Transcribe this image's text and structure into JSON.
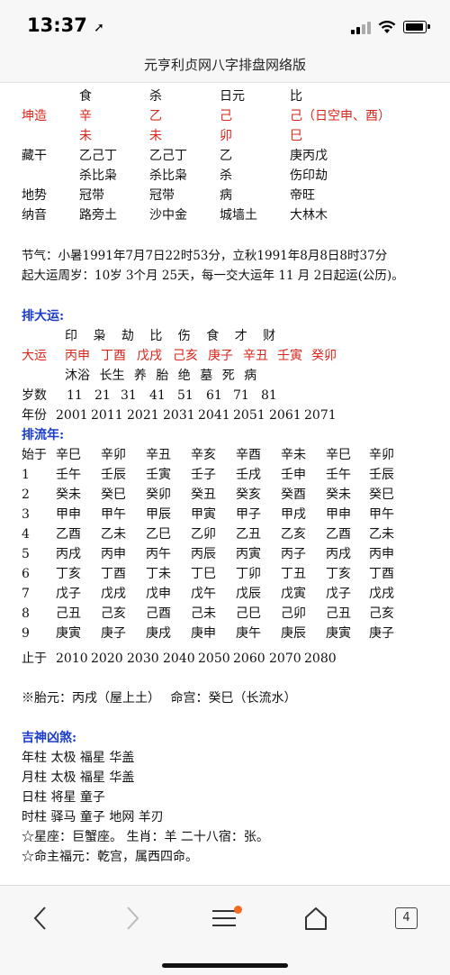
{
  "status": {
    "time": "13:37"
  },
  "page": {
    "title": "元亨利贞网八字排盘网络版"
  },
  "chart": {
    "header_row": [
      "食",
      "杀",
      "日元",
      "比"
    ],
    "kun_label": "坤造",
    "stems": [
      "辛",
      "乙",
      "己",
      "己（日空申、酉）"
    ],
    "branches": [
      "未",
      "未",
      "卯",
      "巳"
    ],
    "cang_label": "藏干",
    "cang": [
      "乙己丁",
      "乙己丁",
      "乙",
      "庚丙戊"
    ],
    "cang_gods": [
      "杀比枭",
      "杀比枭",
      "杀",
      "伤印劫"
    ],
    "dishi_label": "地势",
    "dishi": [
      "冠带",
      "冠带",
      "病",
      "帝旺"
    ],
    "nayin_label": "纳音",
    "nayin": [
      "路旁土",
      "沙中金",
      "城墙土",
      "大林木"
    ]
  },
  "info": {
    "jieqi": "节气：小暑1991年7月7日22时53分，立秋1991年8月8日8时37分",
    "qiyun": "起大运周岁：10岁 3个月 25天，每一交大运年 11 月 2日起运(公历)。"
  },
  "dayun": {
    "heading": "排大运:",
    "gods_row": "印 枭 劫 比 伤 食 才 财",
    "label": "大运",
    "pillars": [
      "丙申",
      "丁酉",
      "戊戌",
      "己亥",
      "庚子",
      "辛丑",
      "壬寅",
      "癸卯"
    ],
    "states_row": "沐浴 长生 养 胎 绝 墓 死 病",
    "age_label": "岁数",
    "ages": [
      "11",
      "21",
      "31",
      "41",
      "51",
      "61",
      "71",
      "81"
    ],
    "year_label": "年份",
    "years": [
      "2001",
      "2011",
      "2021",
      "2031",
      "2041",
      "2051",
      "2061",
      "2071"
    ]
  },
  "liunian": {
    "heading": "排流年:",
    "start_label": "始于",
    "start": [
      "辛巳",
      "辛卯",
      "辛丑",
      "辛亥",
      "辛酉",
      "辛未",
      "辛巳",
      "辛卯"
    ],
    "rows": [
      {
        "n": "1",
        "v": [
          "壬午",
          "壬辰",
          "壬寅",
          "壬子",
          "壬戌",
          "壬申",
          "壬午",
          "壬辰"
        ]
      },
      {
        "n": "2",
        "v": [
          "癸未",
          "癸巳",
          "癸卯",
          "癸丑",
          "癸亥",
          "癸酉",
          "癸未",
          "癸巳"
        ]
      },
      {
        "n": "3",
        "v": [
          "甲申",
          "甲午",
          "甲辰",
          "甲寅",
          "甲子",
          "甲戌",
          "甲申",
          "甲午"
        ]
      },
      {
        "n": "4",
        "v": [
          "乙酉",
          "乙未",
          "乙巳",
          "乙卯",
          "乙丑",
          "乙亥",
          "乙酉",
          "乙未"
        ]
      },
      {
        "n": "5",
        "v": [
          "丙戌",
          "丙申",
          "丙午",
          "丙辰",
          "丙寅",
          "丙子",
          "丙戌",
          "丙申"
        ]
      },
      {
        "n": "6",
        "v": [
          "丁亥",
          "丁酉",
          "丁未",
          "丁巳",
          "丁卯",
          "丁丑",
          "丁亥",
          "丁酉"
        ]
      },
      {
        "n": "7",
        "v": [
          "戊子",
          "戊戌",
          "戊申",
          "戊午",
          "戊辰",
          "戊寅",
          "戊子",
          "戊戌"
        ]
      },
      {
        "n": "8",
        "v": [
          "己丑",
          "己亥",
          "己酉",
          "己未",
          "己巳",
          "己卯",
          "己丑",
          "己亥"
        ]
      },
      {
        "n": "9",
        "v": [
          "庚寅",
          "庚子",
          "庚戌",
          "庚申",
          "庚午",
          "庚辰",
          "庚寅",
          "庚子"
        ]
      }
    ],
    "end_label": "止于",
    "end": [
      "2010",
      "2020",
      "2030",
      "2040",
      "2050",
      "2060",
      "2070",
      "2080"
    ]
  },
  "extra": {
    "taiyuan": "※胎元：丙戌（屋上土）　 命宫：癸巳（长流水）"
  },
  "shensha": {
    "heading": "吉神凶煞:",
    "lines": [
      "年柱 太极 福星 华盖",
      "月柱 太极 福星 华盖",
      "日柱 将星 童子",
      "时柱 驿马 童子 地网 羊刃",
      "☆星座：巨蟹座。 生肖：羊 二十八宿：张。",
      "☆命主福元：乾宫，属西四命。"
    ]
  },
  "browser": {
    "tab_count": "4"
  }
}
